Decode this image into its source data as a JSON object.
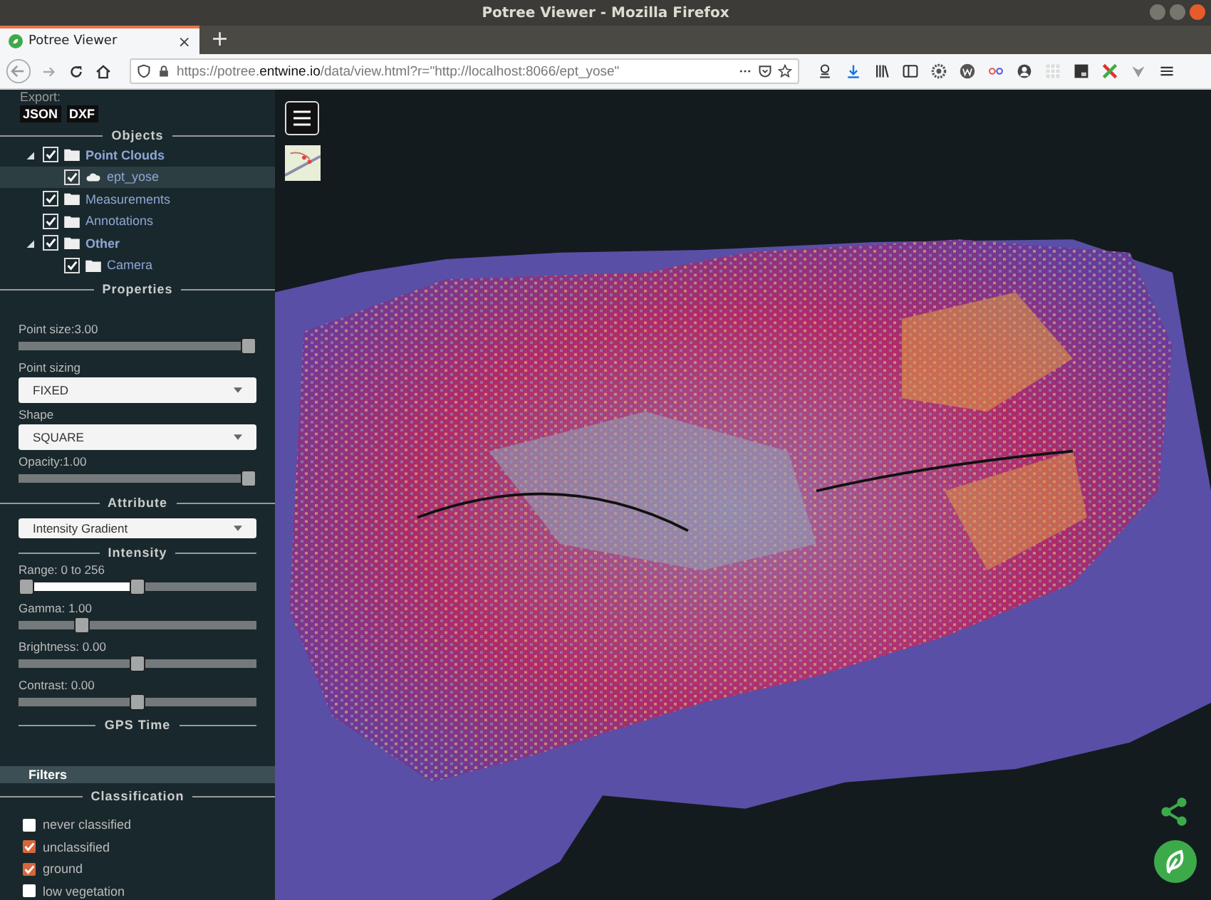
{
  "window": {
    "title": "Potree Viewer - Mozilla Firefox"
  },
  "tab": {
    "title": "Potree Viewer",
    "close": "×",
    "new_tab": "+"
  },
  "address_bar": {
    "url_start": "https://potree.",
    "url_domain": "entwine.io",
    "url_end": "/data/view.html?r=\"http://localhost:8066/ept_yose\""
  },
  "sidebar": {
    "export": {
      "label": "Export:",
      "buttons": [
        "JSON",
        "DXF"
      ]
    },
    "objects": {
      "heading": "Objects",
      "tree": [
        {
          "label": "Point Clouds",
          "kind": "folder",
          "checked": true,
          "expanded": true,
          "selected": false,
          "children": [
            {
              "label": "ept_yose",
              "kind": "cloud",
              "checked": true,
              "expanded": false,
              "selected": true
            }
          ]
        },
        {
          "label": "Measurements",
          "kind": "folder",
          "checked": true,
          "expanded": false,
          "selected": false
        },
        {
          "label": "Annotations",
          "kind": "folder",
          "checked": true,
          "expanded": false,
          "selected": false
        },
        {
          "label": "Other",
          "kind": "folder",
          "checked": true,
          "expanded": true,
          "selected": false,
          "children": [
            {
              "label": "Camera",
              "kind": "folder",
              "checked": true,
              "expanded": false,
              "selected": false
            }
          ]
        }
      ]
    },
    "properties": {
      "heading": "Properties",
      "controls": [
        {
          "kind": "slider",
          "label": "Point size:3.00",
          "level": 1
        },
        {
          "kind": "select",
          "label": "Point sizing",
          "value": "FIXED"
        },
        {
          "kind": "select",
          "label": "Shape",
          "value": "SQUARE"
        },
        {
          "kind": "slider",
          "label": "Opacity:1.00",
          "level": 1
        }
      ]
    },
    "attribute": {
      "heading": "Attribute",
      "value": "Intensity Gradient"
    },
    "intensity": {
      "heading": "Intensity",
      "controls": [
        {
          "kind": "range",
          "label": "Range: 0 to 256",
          "thumbs": [
            {
              "level": 0
            },
            {
              "level": 0.5
            }
          ]
        },
        {
          "kind": "slider",
          "label": "Gamma: 1.00",
          "level": 0.25
        },
        {
          "kind": "slider",
          "label": "Brightness: 0.00",
          "level": 0.5
        },
        {
          "kind": "slider",
          "label": "Contrast: 0.00",
          "level": 0.5
        }
      ]
    },
    "gps_time": {
      "heading": "GPS Time"
    },
    "filters": {
      "title": "Filters"
    },
    "classification": {
      "heading": "Classification",
      "items": [
        {
          "label": "never classified",
          "checked": false
        },
        {
          "label": "unclassified",
          "checked": true
        },
        {
          "label": "ground",
          "checked": true
        },
        {
          "label": "low vegetation",
          "checked": false
        }
      ]
    }
  }
}
